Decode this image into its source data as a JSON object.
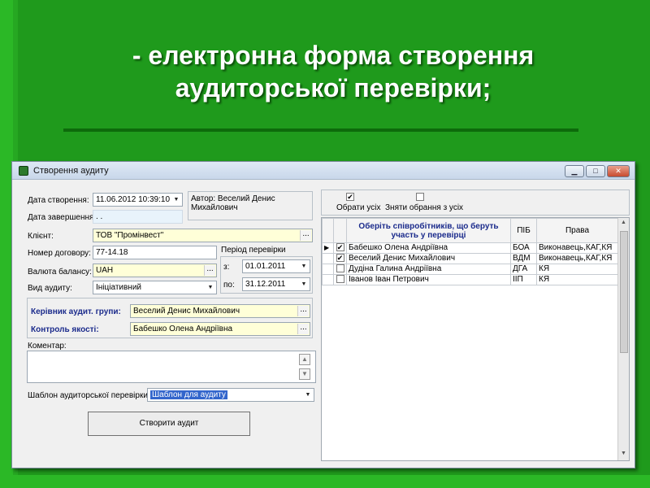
{
  "slide": {
    "title_line1": "- електронна форма створення",
    "title_line2": "аудиторської перевірки;"
  },
  "window": {
    "title": "Створення аудиту",
    "minimize": "▁",
    "maximize": "□",
    "close": "✕"
  },
  "form": {
    "created_label": "Дата створення:",
    "created_value": "11.06.2012 10:39:10",
    "completed_label": "Дата завершення:",
    "completed_value": ". .",
    "author_text": "Автор: Веселий Денис Михайлович",
    "client_label": "Клієнт:",
    "client_value": "ТОВ \"Промінвест\"",
    "contract_label": "Номер договору:",
    "contract_value": "77-14.18",
    "currency_label": "Валюта балансу:",
    "currency_value": "UAH",
    "audit_type_label": "Вид аудиту:",
    "audit_type_value": "Ініціативний",
    "period_label": "Період перевірки",
    "period_from_label": "з:",
    "period_from_value": "01.01.2011",
    "period_to_label": "по:",
    "period_to_value": "31.12.2011",
    "head_label": "Керівник аудит. групи:",
    "head_value": "Веселий Денис Михайлович",
    "quality_label": "Контроль якості:",
    "quality_value": "Бабешко Олена Андріївна",
    "comment_label": "Коментар:",
    "template_label": "Шаблон аудиторської перевірки:",
    "template_value": "Шаблон для аудиту",
    "create_button": "Створити аудит",
    "ellipsis": "...",
    "arrow": "▼"
  },
  "employees": {
    "select_all": "Обрати усіх",
    "deselect_all": "Зняти обрання з усіх",
    "columns": [
      "Оберіть співробітників, що беруть участь у перевірці",
      "ПІБ",
      "Права"
    ],
    "rows": [
      {
        "checked": "✔",
        "name": "Бабешко Олена Андріївна",
        "code": "БОА",
        "rights": "Виконавець,КАГ,КЯ",
        "pointer": "▶"
      },
      {
        "checked": "✔",
        "name": "Веселий Денис Михайлович",
        "code": "ВДМ",
        "rights": "Виконавець,КАГ,КЯ",
        "pointer": ""
      },
      {
        "checked": "",
        "name": "Дудіна Галина Андріївна",
        "code": "ДГА",
        "rights": "КЯ",
        "pointer": ""
      },
      {
        "checked": "",
        "name": "Іванов Іван Петрович",
        "code": "ІІП",
        "rights": "КЯ",
        "pointer": ""
      }
    ]
  }
}
